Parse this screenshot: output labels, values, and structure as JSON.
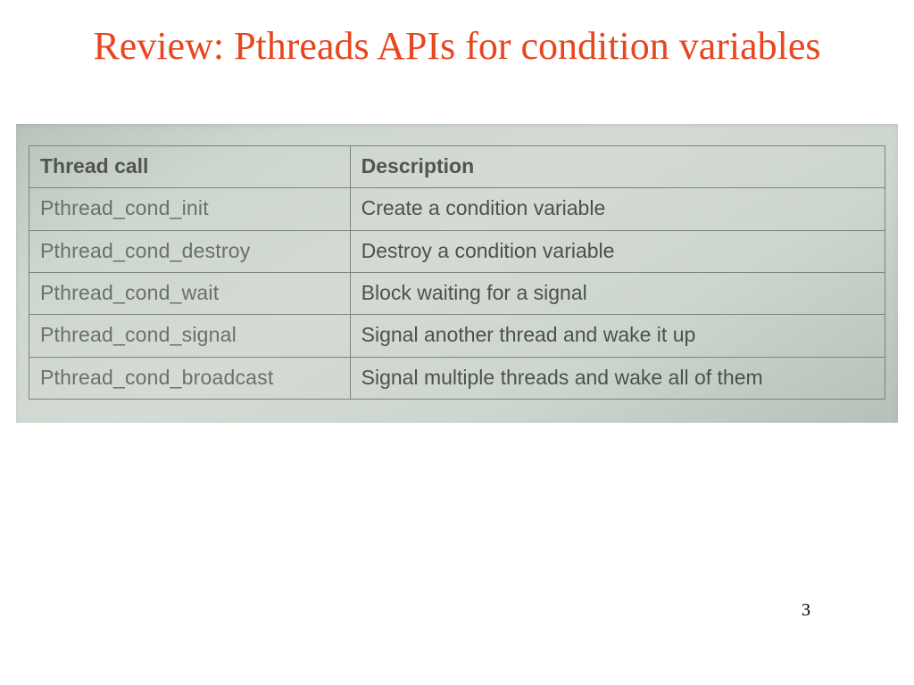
{
  "title": "Review: Pthreads APIs for condition variables",
  "table": {
    "headers": {
      "col1": "Thread call",
      "col2": "Description"
    },
    "rows": [
      {
        "call": "Pthread_cond_init",
        "desc": "Create a condition variable"
      },
      {
        "call": "Pthread_cond_destroy",
        "desc": "Destroy a condition variable"
      },
      {
        "call": "Pthread_cond_wait",
        "desc": "Block waiting for a signal"
      },
      {
        "call": "Pthread_cond_signal",
        "desc": "Signal another thread and wake it up"
      },
      {
        "call": "Pthread_cond_broadcast",
        "desc": "Signal multiple threads and wake all of them"
      }
    ]
  },
  "page_number": "3"
}
